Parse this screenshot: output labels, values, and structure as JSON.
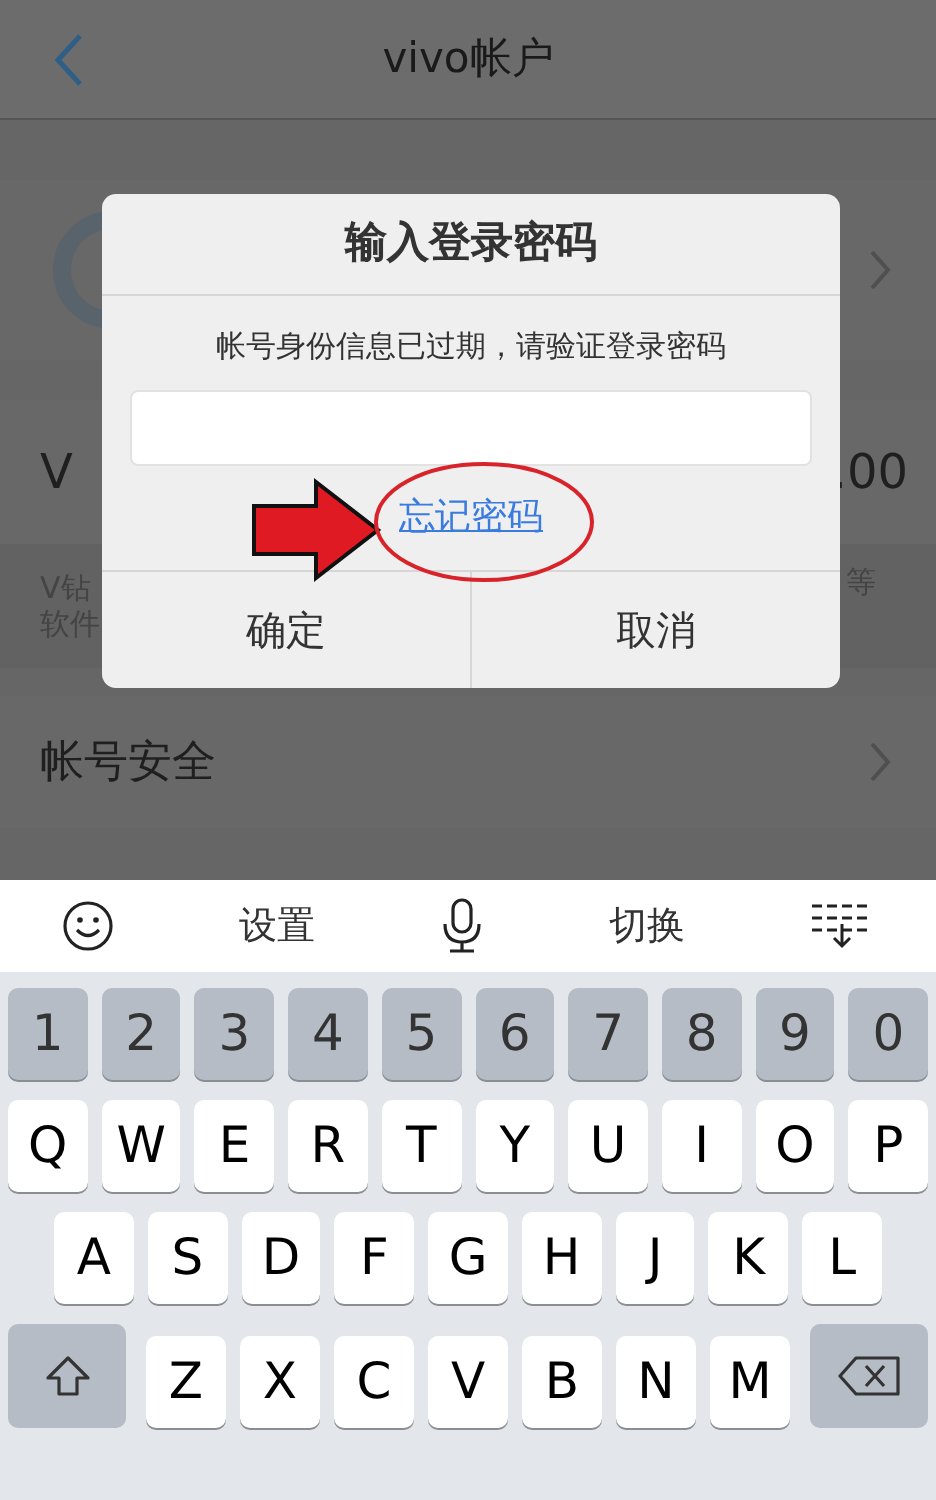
{
  "nav_bar": {
    "title": "vivo帐户"
  },
  "background_rows": [
    {
      "kind": "account"
    },
    {
      "kind": "balance",
      "label": "V",
      "value": ".00"
    },
    {
      "kind": "note",
      "left_lines": [
        "V钻",
        "软件"
      ],
      "right": "等"
    },
    {
      "kind": "link",
      "label": "帐号安全"
    }
  ],
  "dialog": {
    "title": "输入登录密码",
    "message": "帐号身份信息已过期，请验证登录密码",
    "forgot_link": "忘记密码",
    "buttons": [
      "确定",
      "取消"
    ]
  },
  "keyboard": {
    "toolbar": [
      {
        "kind": "emoji"
      },
      {
        "kind": "text",
        "label": "设置"
      },
      {
        "kind": "mic"
      },
      {
        "kind": "text",
        "label": "切换"
      },
      {
        "kind": "collapse"
      }
    ],
    "rows": [
      {
        "kind": "numbers",
        "keys": [
          "1",
          "2",
          "3",
          "4",
          "5",
          "6",
          "7",
          "8",
          "9",
          "0"
        ]
      },
      {
        "kind": "letters",
        "keys": [
          "Q",
          "W",
          "E",
          "R",
          "T",
          "Y",
          "U",
          "I",
          "O",
          "P"
        ]
      },
      {
        "kind": "letters_inset",
        "keys": [
          "A",
          "S",
          "D",
          "F",
          "G",
          "H",
          "J",
          "K",
          "L"
        ]
      },
      {
        "kind": "letters_shift",
        "keys": [
          "Z",
          "X",
          "C",
          "V",
          "B",
          "N",
          "M"
        ]
      }
    ]
  }
}
